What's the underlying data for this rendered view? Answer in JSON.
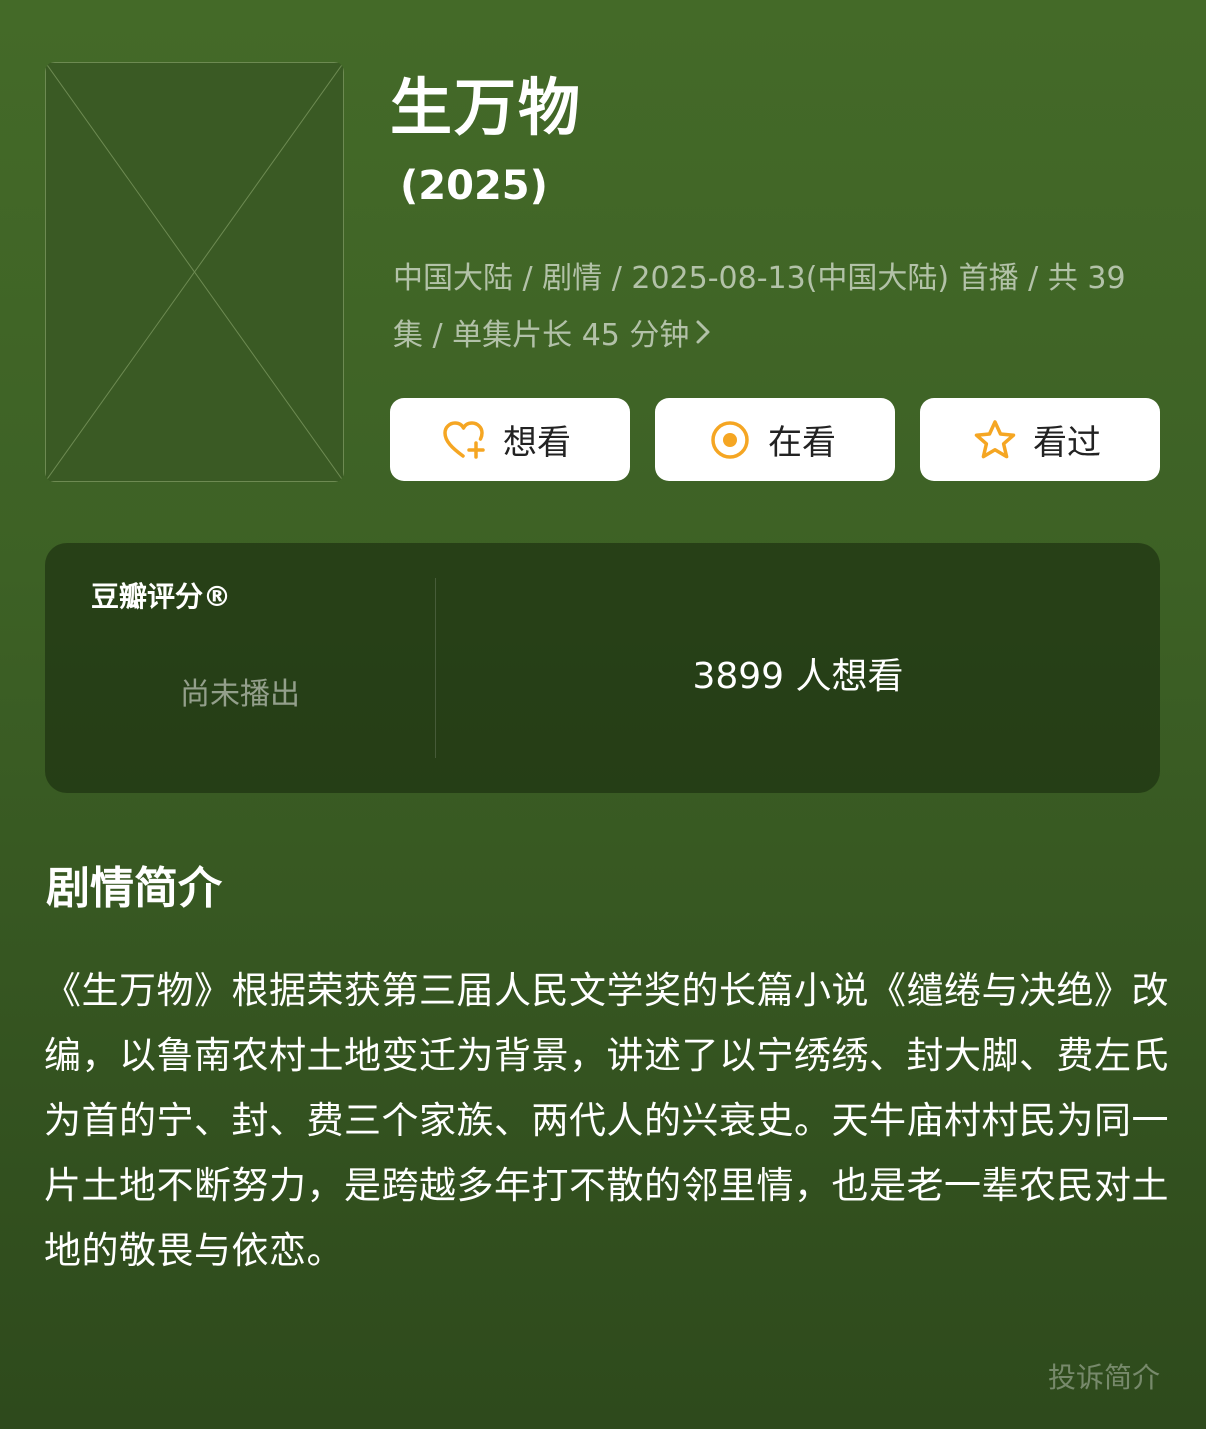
{
  "title": "生万物",
  "year": "(2025)",
  "meta_line": "中国大陆 / 剧情 / 2025-08-13(中国大陆) 首播 / 共 39 集 / 单集片长 45 分钟",
  "actions": {
    "want": "想看",
    "watching": "在看",
    "watched": "看过"
  },
  "rating": {
    "label": "豆瓣评分®",
    "status": "尚未播出",
    "wish_count": "3899 人想看"
  },
  "synopsis": {
    "heading": "剧情简介",
    "text": "《生万物》根据荣获第三届人民文学奖的长篇小说《缱绻与决绝》改编，以鲁南农村土地变迁为背景，讲述了以宁绣绣、封大脚、费左氏为首的宁、封、费三个家族、两代人的兴衰史。天牛庙村村民为同一片土地不断努力，是跨越多年打不散的邻里情，也是老一辈农民对土地的敬畏与依恋。",
    "report_label": "投诉简介"
  },
  "colors": {
    "accent": "#f5a623",
    "background": "#3d6125",
    "card": "#ffffff"
  },
  "icons": {
    "want": "heart-plus-icon",
    "watching": "target-circle-icon",
    "watched": "star-icon",
    "meta_more": "chevron-right-icon"
  }
}
